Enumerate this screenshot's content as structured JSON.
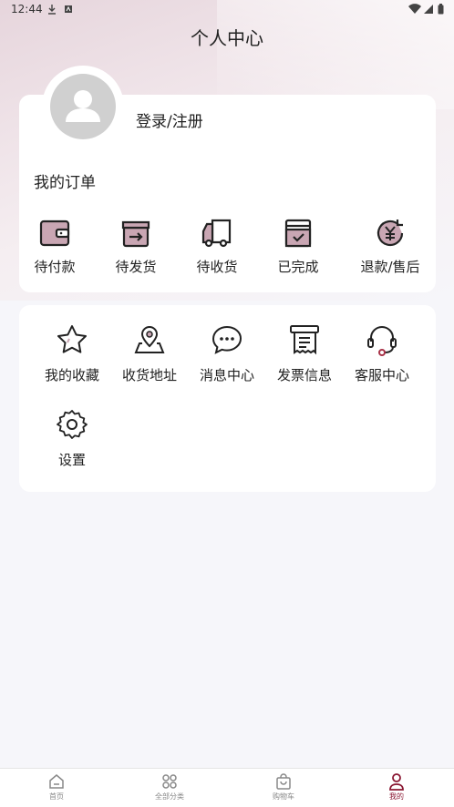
{
  "status_bar": {
    "time": "12:44"
  },
  "header": {
    "title": "个人中心"
  },
  "profile": {
    "login_label": "登录/注册"
  },
  "orders": {
    "title": "我的订单",
    "items": [
      {
        "label": "待付款",
        "icon": "wallet-icon"
      },
      {
        "label": "待发货",
        "icon": "box-arrow-icon"
      },
      {
        "label": "待收货",
        "icon": "truck-icon"
      },
      {
        "label": "已完成",
        "icon": "completed-box-icon"
      },
      {
        "label": "退款/售后",
        "icon": "refund-icon"
      }
    ]
  },
  "services": {
    "items": [
      {
        "label": "我的收藏",
        "icon": "star-icon"
      },
      {
        "label": "收货地址",
        "icon": "location-icon"
      },
      {
        "label": "消息中心",
        "icon": "chat-icon"
      },
      {
        "label": "发票信息",
        "icon": "invoice-icon"
      },
      {
        "label": "客服中心",
        "icon": "headset-icon"
      },
      {
        "label": "设置",
        "icon": "gear-icon"
      }
    ]
  },
  "tabbar": {
    "items": [
      {
        "label": "首页",
        "icon": "home-icon"
      },
      {
        "label": "全部分类",
        "icon": "grid-icon"
      },
      {
        "label": "购物车",
        "icon": "bag-icon"
      },
      {
        "label": "我的",
        "icon": "person-icon",
        "active": true
      }
    ]
  },
  "colors": {
    "accent": "#8a1732",
    "icon_fill": "#c9a6b3"
  }
}
